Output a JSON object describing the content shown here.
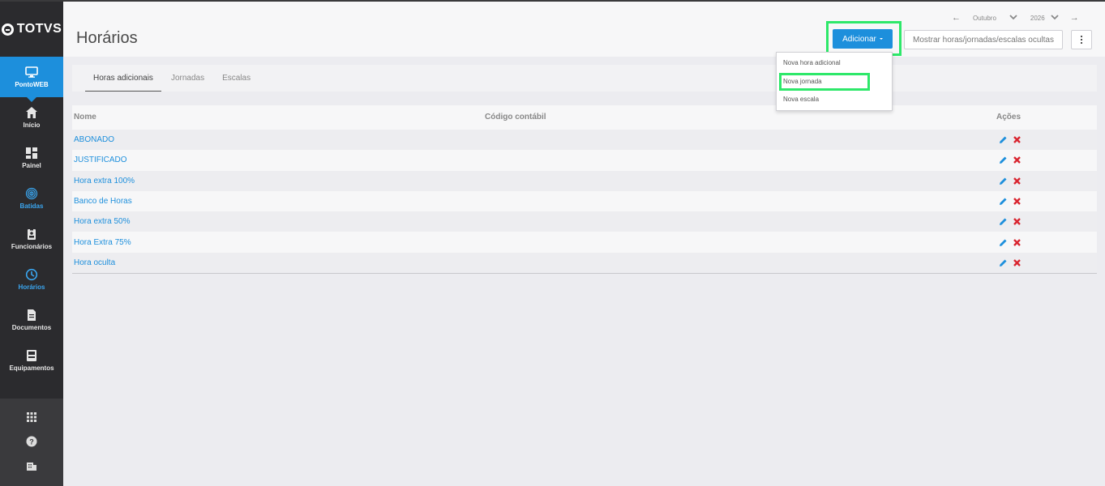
{
  "brand": {
    "logo_text": "TOTVS"
  },
  "sidebar": {
    "items": [
      {
        "label": "PontoWEB",
        "icon": "monitor-icon"
      },
      {
        "label": "Início",
        "icon": "home-icon"
      },
      {
        "label": "Painel",
        "icon": "dashboard-icon"
      },
      {
        "label": "Batidas",
        "icon": "fingerprint-icon"
      },
      {
        "label": "Funcionários",
        "icon": "badge-icon"
      },
      {
        "label": "Horários",
        "icon": "clock-icon"
      },
      {
        "label": "Documentos",
        "icon": "document-icon"
      },
      {
        "label": "Equipamentos",
        "icon": "device-icon"
      }
    ],
    "bottom_icons": [
      "apps-grid-icon",
      "help-icon",
      "building-icon"
    ]
  },
  "header": {
    "title": "Horários",
    "month": "Outubro",
    "year": "2026",
    "add_label": "Adicionar",
    "show_hidden_label": "Mostrar horas/jornadas/escalas ocultas"
  },
  "dropdown": {
    "items": [
      "Nova hora adicional",
      "Nova jornada",
      "Nova escala"
    ]
  },
  "tabs": [
    "Horas adicionais",
    "Jornadas",
    "Escalas"
  ],
  "table": {
    "columns": [
      "Nome",
      "Código contábil",
      "Ações"
    ],
    "rows": [
      {
        "name": "ABONADO"
      },
      {
        "name": "JUSTIFICADO"
      },
      {
        "name": "Hora extra 100%"
      },
      {
        "name": "Banco de Horas"
      },
      {
        "name": "Hora extra 50%"
      },
      {
        "name": "Hora Extra 75%"
      },
      {
        "name": "Hora oculta"
      }
    ]
  },
  "colors": {
    "accent": "#1d8fdc",
    "highlight": "#2ee86a",
    "delete": "#d9242f",
    "sidebar": "#2b2b2e"
  }
}
